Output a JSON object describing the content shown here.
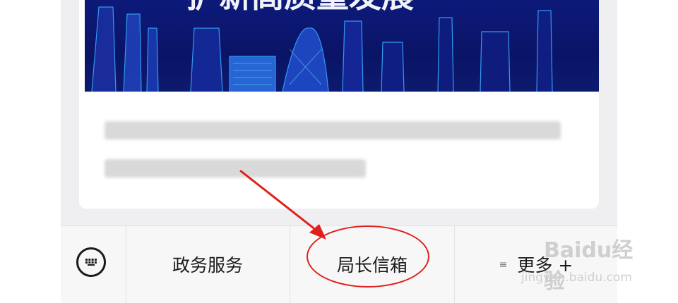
{
  "banner": {
    "headline_partial": "扩新高质量发展"
  },
  "toolbar": {
    "items": [
      {
        "label": "政务服务"
      },
      {
        "label": "局长信箱"
      },
      {
        "label": "更多 +"
      }
    ]
  },
  "colors": {
    "accent_red": "#e0201c",
    "banner_dark": "#0d1a7a"
  },
  "watermark": {
    "brand": "Baidu经验",
    "url": "jingyan.baidu.com"
  }
}
